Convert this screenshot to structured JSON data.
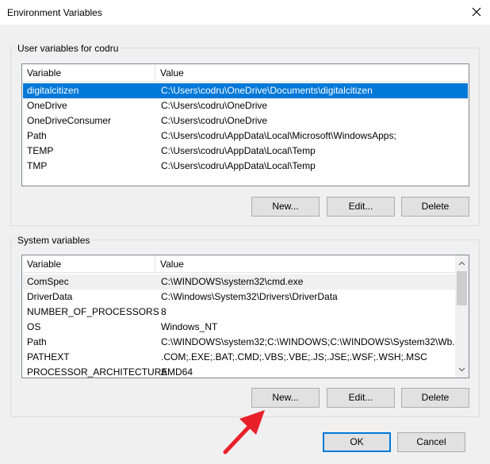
{
  "window": {
    "title": "Environment Variables"
  },
  "user_group": {
    "label": "User variables for codru",
    "columns": [
      "Variable",
      "Value"
    ],
    "rows": [
      {
        "variable": "digitalcitizen",
        "value": "C:\\Users\\codru\\OneDrive\\Documents\\digitalcitizen",
        "selected": true
      },
      {
        "variable": "OneDrive",
        "value": "C:\\Users\\codru\\OneDrive"
      },
      {
        "variable": "OneDriveConsumer",
        "value": "C:\\Users\\codru\\OneDrive"
      },
      {
        "variable": "Path",
        "value": "C:\\Users\\codru\\AppData\\Local\\Microsoft\\WindowsApps;"
      },
      {
        "variable": "TEMP",
        "value": "C:\\Users\\codru\\AppData\\Local\\Temp"
      },
      {
        "variable": "TMP",
        "value": "C:\\Users\\codru\\AppData\\Local\\Temp"
      }
    ],
    "buttons": {
      "new": "New...",
      "edit": "Edit...",
      "delete": "Delete"
    }
  },
  "system_group": {
    "label": "System variables",
    "columns": [
      "Variable",
      "Value"
    ],
    "rows": [
      {
        "variable": "ComSpec",
        "value": "C:\\WINDOWS\\system32\\cmd.exe"
      },
      {
        "variable": "DriverData",
        "value": "C:\\Windows\\System32\\Drivers\\DriverData"
      },
      {
        "variable": "NUMBER_OF_PROCESSORS",
        "value": "8"
      },
      {
        "variable": "OS",
        "value": "Windows_NT"
      },
      {
        "variable": "Path",
        "value": "C:\\WINDOWS\\system32;C:\\WINDOWS;C:\\WINDOWS\\System32\\Wb..."
      },
      {
        "variable": "PATHEXT",
        "value": ".COM;.EXE;.BAT;.CMD;.VBS;.VBE;.JS;.JSE;.WSF;.WSH;.MSC"
      },
      {
        "variable": "PROCESSOR_ARCHITECTURE",
        "value": "AMD64"
      }
    ],
    "buttons": {
      "new": "New...",
      "edit": "Edit...",
      "delete": "Delete"
    }
  },
  "footer": {
    "ok": "OK",
    "cancel": "Cancel"
  },
  "colors": {
    "selection": "#0078d7",
    "annotation_arrow": "#e8202a"
  }
}
